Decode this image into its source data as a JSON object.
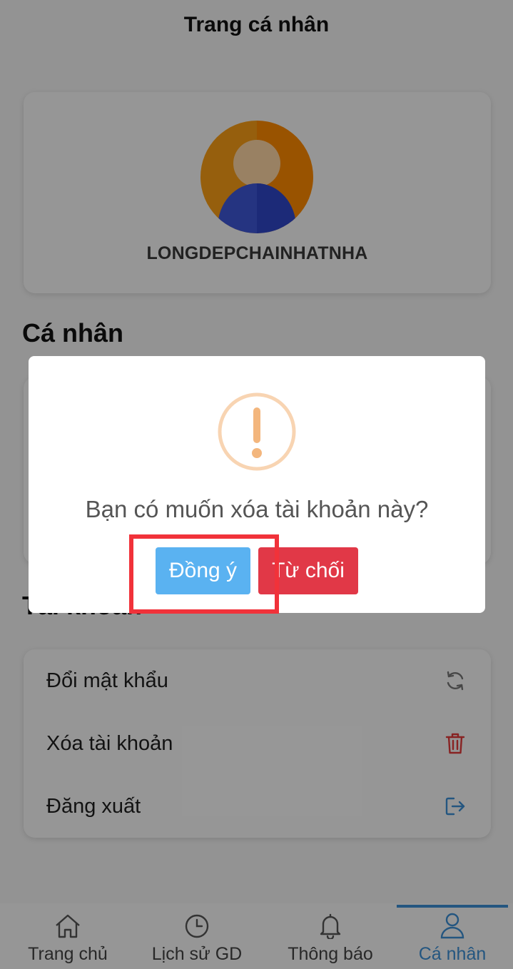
{
  "header": {
    "title": "Trang cá nhân"
  },
  "profile": {
    "username": "LONGDEPCHAINHATNHA"
  },
  "sections": {
    "personal_title": "Cá nhân",
    "account_title": "Tài khoản"
  },
  "account_items": [
    {
      "label": "Đổi mật khẩu",
      "icon": "refresh-icon"
    },
    {
      "label": "Xóa tài khoản",
      "icon": "trash-icon"
    },
    {
      "label": "Đăng xuất",
      "icon": "logout-icon"
    }
  ],
  "bottom_nav": [
    {
      "label": "Trang chủ",
      "icon": "home-icon"
    },
    {
      "label": "Lịch sử GD",
      "icon": "clock-icon"
    },
    {
      "label": "Thông báo",
      "icon": "bell-icon"
    },
    {
      "label": "Cá nhân",
      "icon": "user-icon",
      "active": true
    }
  ],
  "dialog": {
    "icon": "warning-icon",
    "message": "Bạn có muốn xóa tài khoản này?",
    "confirm_label": "Đồng ý",
    "cancel_label": "Từ chối"
  },
  "colors": {
    "accent": "#3d8fd6",
    "confirm": "#5ab2f1",
    "cancel": "#e13847",
    "warning": "#f0ad6f",
    "highlight": "#f1323a"
  }
}
